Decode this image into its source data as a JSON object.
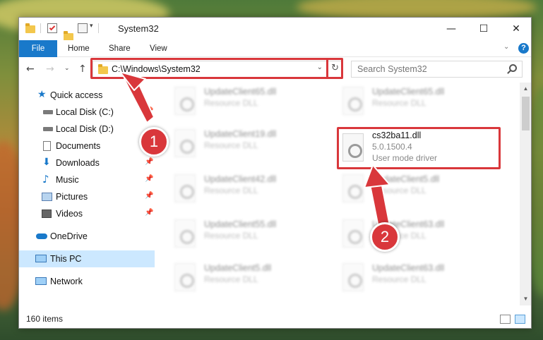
{
  "window": {
    "title": "System32",
    "controls": {
      "minimize": "—",
      "maximize": "☐",
      "close": "✕"
    }
  },
  "ribbon": {
    "tabs": [
      {
        "label": "File"
      },
      {
        "label": "Home"
      },
      {
        "label": "Share"
      },
      {
        "label": "View"
      }
    ],
    "help": "?"
  },
  "address": {
    "path": "C:\\Windows\\System32",
    "search_placeholder": "Search System32"
  },
  "nav_pane": {
    "quick_access": "Quick access",
    "items": [
      {
        "label": "Local Disk (C:)"
      },
      {
        "label": "Local Disk (D:)"
      },
      {
        "label": "Documents"
      },
      {
        "label": "Downloads"
      },
      {
        "label": "Music"
      },
      {
        "label": "Pictures"
      },
      {
        "label": "Videos"
      }
    ],
    "onedrive": "OneDrive",
    "this_pc": "This PC",
    "network": "Network"
  },
  "files": {
    "left_column": [
      {
        "name": "UpdateClient65.dll",
        "desc": "Resource DLL"
      },
      {
        "name": "UpdateClient19.dll",
        "desc": "Resource DLL"
      },
      {
        "name": "UpdateClient42.dll",
        "desc": "Resource DLL"
      },
      {
        "name": "UpdateClient55.dll",
        "desc": "Resource DLL"
      },
      {
        "name": "UpdateClient5.dll",
        "desc": "Resource DLL"
      }
    ],
    "right_column": [
      {
        "name": "UpdateClient65.dll",
        "desc": "Resource DLL"
      },
      {
        "name": "UpdateClient5.dll",
        "desc": "Resource DLL"
      },
      {
        "name": "UpdateClient63.dll",
        "desc": "Resource DLL"
      },
      {
        "name": "UpdateClient63.dll",
        "desc": "Resource DLL"
      }
    ],
    "highlighted": {
      "name": "cs32ba11.dll",
      "version": "5.0.1500.4",
      "desc": "User mode driver"
    }
  },
  "status": {
    "count": "160 items"
  },
  "callouts": {
    "one": "1",
    "two": "2"
  },
  "colors": {
    "accent": "#1979ca",
    "highlight": "#d9373b",
    "selection": "#cce8ff"
  }
}
